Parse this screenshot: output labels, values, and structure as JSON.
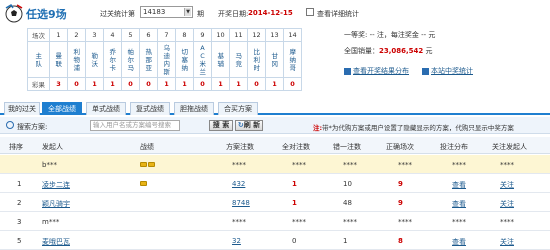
{
  "brand": "任选9场",
  "period": {
    "label": "过关统计第",
    "value": "14183",
    "unit": "期"
  },
  "draw": {
    "label": "开奖日期:",
    "date": "2014-12-15"
  },
  "history_checkbox": "查看详细统计",
  "matches": {
    "headers": [
      "场次",
      "主队",
      "客队",
      "彩果"
    ],
    "numbers": [
      "1",
      "2",
      "3",
      "4",
      "5",
      "6",
      "7",
      "8",
      "9",
      "10",
      "11",
      "12",
      "13",
      "14"
    ],
    "teams": [
      "曼联",
      "利物浦",
      "勒沃",
      "乔尔卡",
      "帕尔马",
      "热那亚",
      "乌迪内斯",
      "切塞纳",
      "AC米兰",
      "基辅",
      "马竞",
      "比利时",
      "甘冈",
      "摩纳哥"
    ],
    "results": [
      "3",
      "0",
      "1",
      "1",
      "0",
      "0",
      "1",
      "1",
      "0",
      "1",
      "1",
      "0",
      "1",
      "0"
    ]
  },
  "info": {
    "l1": "一等奖:  --  注，每注奖金  --  元",
    "l2_label": "全国销量：",
    "l2_value": "23,086,542",
    "l2_unit": "元"
  },
  "links": {
    "l1": "查看开奖结果分布",
    "l2": "本站中奖统计"
  },
  "tabs": [
    "我的过关",
    "全部战绩",
    "单式战绩",
    "复式战绩",
    "胆拖战绩",
    "合买方案"
  ],
  "search": {
    "label": "搜索方案:",
    "placeholder": "输入用户名或方案编号搜索",
    "btn1": "搜 索",
    "btn2": "刷 新",
    "note_prefix": "注:",
    "note": "带*为代购方案或用户设置了隐藏显示的方案，代购只显示中奖方案"
  },
  "table": {
    "headers": [
      "排序",
      "发起人",
      "战绩",
      "方案注数",
      "全对注数",
      "错一注数",
      "正确场次",
      "投注分布",
      "关注发起人"
    ],
    "rows": [
      {
        "rank": "",
        "user": "b***",
        "crowns": 2,
        "bets": "****",
        "all": "****",
        "err1": "****",
        "correct": "****",
        "dist": "****",
        "follow": "****",
        "hl": true
      },
      {
        "rank": "1",
        "user": "凌步二连",
        "crowns": 1,
        "bets": "432",
        "all": "1",
        "err1": "10",
        "correct": "9",
        "dist": "查看",
        "follow": "关注",
        "hl": false
      },
      {
        "rank": "2",
        "user": "颖凡骑宇",
        "crowns": 0,
        "bets": "8748",
        "all": "1",
        "err1": "48",
        "correct": "9",
        "dist": "查看",
        "follow": "关注",
        "hl": false
      },
      {
        "rank": "3",
        "user": "m***",
        "crowns": 0,
        "bets": "****",
        "all": "****",
        "err1": "****",
        "correct": "****",
        "dist": "****",
        "follow": "****",
        "hl": false
      },
      {
        "rank": "5",
        "user": "麦哦巴瓦",
        "crowns": 0,
        "bets": "32",
        "all": "0",
        "err1": "1",
        "correct": "8",
        "dist": "查看",
        "follow": "关注",
        "hl": false
      }
    ]
  }
}
